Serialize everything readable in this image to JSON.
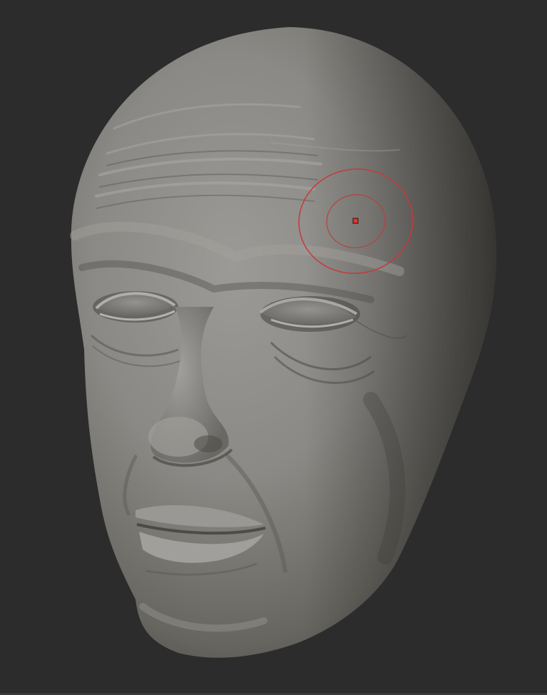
{
  "viewport": {
    "background_color": "#2c2c2c",
    "model": {
      "subject": "sculpted-head",
      "material_color": "#8e8c88"
    },
    "brush_cursor": {
      "color": "#d23a3a",
      "center_marker_color": "#e0382e"
    }
  }
}
